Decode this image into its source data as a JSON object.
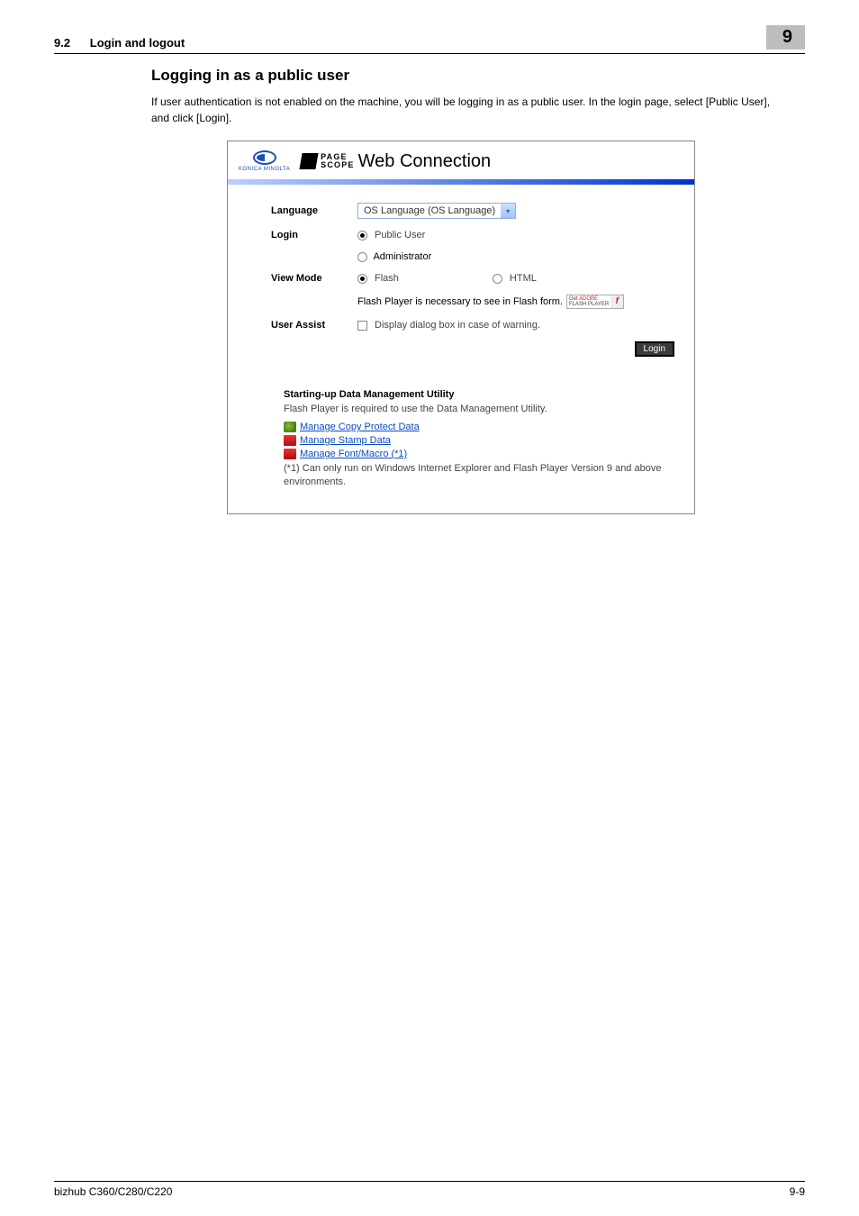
{
  "header": {
    "section": "9.2",
    "section_title": "Login and logout",
    "chapter": "9"
  },
  "content": {
    "heading": "Logging in as a public user",
    "paragraph": "If user authentication is not enabled on the machine, you will be logging in as a public user. In the login page, select [Public User], and click [Login]."
  },
  "screenshot": {
    "logo_brand": "KONICA MINOLTA",
    "pagescope_top": "PAGE",
    "pagescope_bot": "SCOPE",
    "pagescope_title": "Web Connection",
    "form": {
      "language_label": "Language",
      "language_value": "OS Language (OS Language)",
      "login_label": "Login",
      "login_public": "Public User",
      "login_admin": "Administrator",
      "viewmode_label": "View Mode",
      "viewmode_flash": "Flash",
      "viewmode_html": "HTML",
      "flash_note": "Flash Player is necessary to see in Flash form.",
      "flash_badge_get": "Get ",
      "flash_badge_adobe": "ADOBE",
      "flash_badge_fp": "FLASH PLAYER",
      "userassist_label": "User Assist",
      "userassist_opt": "Display dialog box in case of warning.",
      "login_btn": "Login"
    },
    "dmu": {
      "title": "Starting-up Data Management Utility",
      "subtitle": "Flash Player is required to use the Data Management Utility.",
      "link_copy": "Manage Copy Protect Data",
      "link_stamp": "Manage Stamp Data",
      "link_font": "Manage Font/Macro (*1)",
      "note": "(*1) Can only run on Windows Internet Explorer and Flash Player Version 9 and above environments."
    }
  },
  "footer": {
    "model": "bizhub C360/C280/C220",
    "page": "9-9"
  }
}
